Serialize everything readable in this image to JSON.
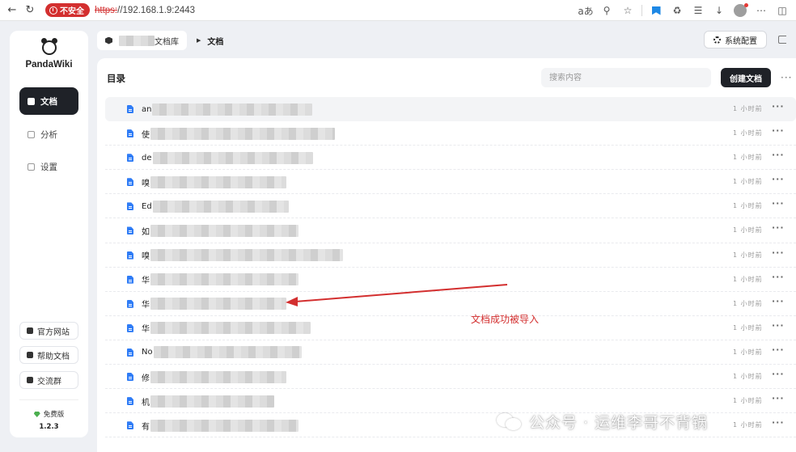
{
  "browser": {
    "insecure_label": "不安全",
    "url_protocol": "https:",
    "url_rest": "//192.168.1.9:2443",
    "read_aloud": "aあ"
  },
  "sidebar": {
    "app_name": "PandaWiki",
    "menu": [
      {
        "label": "文档",
        "active": true
      },
      {
        "label": "分析",
        "active": false
      },
      {
        "label": "设置",
        "active": false
      }
    ],
    "links": [
      "官方网站",
      "帮助文档",
      "交流群"
    ],
    "edition": "免费版",
    "version": "1.2.3"
  },
  "header": {
    "kb_name_suffix": "文档库",
    "current": "文档",
    "system_config": "系统配置"
  },
  "panel": {
    "title": "目录",
    "search_placeholder": "搜索内容",
    "create_label": "创建文档",
    "more": "···"
  },
  "documents": [
    {
      "prefix": "an",
      "time": "1 小时前",
      "blur": 198
    },
    {
      "prefix": "使",
      "time": "1 小时前",
      "blur": 228
    },
    {
      "prefix": "de",
      "time": "1 小时前",
      "blur": 198
    },
    {
      "prefix": "嗅",
      "time": "1 小时前",
      "blur": 168
    },
    {
      "prefix": "Ed",
      "time": "1 小时前",
      "blur": 168
    },
    {
      "prefix": "如",
      "time": "1 小时前",
      "blur": 183
    },
    {
      "prefix": "嗅",
      "time": "1 小时前",
      "blur": 238
    },
    {
      "prefix": "华",
      "time": "1 小时前",
      "blur": 183
    },
    {
      "prefix": "华",
      "time": "1 小时前",
      "blur": 168
    },
    {
      "prefix": "华",
      "time": "1 小时前",
      "blur": 198
    },
    {
      "prefix": "No",
      "time": "1 小时前",
      "blur": 183
    },
    {
      "prefix": "修",
      "time": "1 小时前",
      "blur": 168
    },
    {
      "prefix": "机",
      "time": "1 小时前",
      "blur": 153
    },
    {
      "prefix": "有",
      "time": "1 小时前",
      "blur": 183
    }
  ],
  "annotation": {
    "text": "文档成功被导入",
    "color": "#d32f2f"
  },
  "watermark": "公众号 · 运维李哥不背锅",
  "colors": {
    "dark": "#1f2228",
    "doc_icon": "#2f7cf6",
    "insecure": "#d32f2f"
  }
}
